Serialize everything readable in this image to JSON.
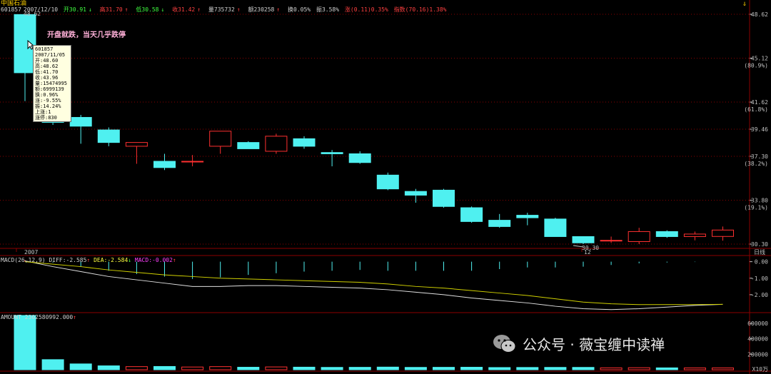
{
  "header": {
    "stock_name": "中国石油",
    "code": "601857",
    "date": "2007/12/10",
    "open": "开30.91",
    "open_arrow": "↓",
    "high": "高31.70",
    "high_arrow": "↑",
    "low": "低30.58",
    "low_arrow": "↓",
    "close": "收31.42",
    "close_arrow": "↑",
    "volume": "量735732",
    "volume_arrow": "↑",
    "amount": "额230258",
    "amount_arrow": "↑",
    "turnover": "换0.05%",
    "amplitude": "振3.58%",
    "change": "涨(0.11)0.35%",
    "index": "指数(70.16)1.38%"
  },
  "annotation": "开盘就跌，当天几乎跌停",
  "tooltip": {
    "lines": [
      "601857",
      "2007/11/05",
      "开:48.60",
      "高:48.62",
      "低:41.70",
      "收:43.96",
      "量:15474995",
      "额:6999139",
      "换:0.96%",
      "涨:-9.55%",
      "振:14.24%",
      "上涨:1",
      "涨停:830"
    ]
  },
  "price_axis": {
    "labels": [
      "48.62",
      "45.12",
      "41.62",
      "39.46",
      "37.30",
      "33.80",
      "30.30"
    ],
    "pct_labels": [
      "(80.9%)",
      "(61.8%)",
      "(38.2%)",
      "(19.1%)"
    ]
  },
  "top_price_label": "48.62",
  "low_price_label": "30.30",
  "x_axis": {
    "label_2007": "2007",
    "label_12": "12",
    "period": "日线"
  },
  "macd": {
    "label": "MACD(26,12,9)",
    "diff": "DIFF:-2.585",
    "diff_arrow": "↑",
    "dea": "DEA:-2.584",
    "dea_arrow": "↓",
    "macd_val": "MACD:-0.002",
    "macd_arrow": "↑",
    "axis_labels": [
      "0.00",
      "-1.00",
      "-2.00"
    ]
  },
  "amount_panel": {
    "label": "AMOUNT 2302580992.000",
    "arrow": "↑",
    "axis_labels": [
      "600000",
      "400000",
      "200000",
      "X10万"
    ]
  },
  "watermark": "公众号 · 薇宝缠中读禅",
  "colors": {
    "up": "#ff3030",
    "down": "#4ff0f0",
    "grid": "#8b0000",
    "diff": "#e0e0e0",
    "dea": "#d0d000"
  },
  "chart_data": {
    "type": "candlestick",
    "candles": [
      {
        "o": 48.6,
        "h": 48.62,
        "l": 41.7,
        "c": 43.96,
        "amt": 69.99
      },
      {
        "o": 43.2,
        "h": 43.8,
        "l": 39.8,
        "c": 40.0,
        "amt": 13.0
      },
      {
        "o": 40.4,
        "h": 40.6,
        "l": 38.3,
        "c": 39.7,
        "amt": 7.5
      },
      {
        "o": 39.4,
        "h": 39.6,
        "l": 38.1,
        "c": 38.4,
        "amt": 5.0
      },
      {
        "o": 38.1,
        "h": 38.4,
        "l": 36.7,
        "c": 38.4,
        "amt": 4.0
      },
      {
        "o": 36.9,
        "h": 37.5,
        "l": 36.2,
        "c": 36.4,
        "amt": 4.2
      },
      {
        "o": 36.9,
        "h": 37.4,
        "l": 36.5,
        "c": 36.9,
        "amt": 3.5
      },
      {
        "o": 38.1,
        "h": 39.2,
        "l": 37.5,
        "c": 39.3,
        "amt": 4.0
      },
      {
        "o": 38.4,
        "h": 38.5,
        "l": 37.9,
        "c": 37.9,
        "amt": 3.2
      },
      {
        "o": 37.7,
        "h": 39.1,
        "l": 37.5,
        "c": 38.9,
        "amt": 3.6
      },
      {
        "o": 38.7,
        "h": 38.9,
        "l": 37.9,
        "c": 38.1,
        "amt": 3.3
      },
      {
        "o": 37.6,
        "h": 37.8,
        "l": 36.5,
        "c": 37.5,
        "amt": 3.0
      },
      {
        "o": 37.5,
        "h": 37.7,
        "l": 36.7,
        "c": 36.8,
        "amt": 3.1
      },
      {
        "o": 35.8,
        "h": 36.0,
        "l": 34.6,
        "c": 34.7,
        "amt": 3.4
      },
      {
        "o": 34.5,
        "h": 34.7,
        "l": 33.6,
        "c": 34.2,
        "amt": 3.0
      },
      {
        "o": 34.6,
        "h": 34.7,
        "l": 33.2,
        "c": 33.3,
        "amt": 3.1
      },
      {
        "o": 33.2,
        "h": 33.3,
        "l": 32.0,
        "c": 32.1,
        "amt": 3.2
      },
      {
        "o": 32.2,
        "h": 32.7,
        "l": 31.6,
        "c": 31.7,
        "amt": 2.8
      },
      {
        "o": 32.6,
        "h": 32.8,
        "l": 31.8,
        "c": 32.4,
        "amt": 2.9
      },
      {
        "o": 32.3,
        "h": 32.4,
        "l": 30.9,
        "c": 30.9,
        "amt": 3.0
      },
      {
        "o": 30.9,
        "h": 30.9,
        "l": 30.3,
        "c": 30.4,
        "amt": 3.0
      },
      {
        "o": 30.6,
        "h": 30.9,
        "l": 30.4,
        "c": 30.6,
        "amt": 2.4
      },
      {
        "o": 30.5,
        "h": 31.6,
        "l": 30.3,
        "c": 31.3,
        "amt": 2.6
      },
      {
        "o": 31.3,
        "h": 31.4,
        "l": 30.8,
        "c": 30.9,
        "amt": 2.4
      },
      {
        "o": 30.9,
        "h": 31.3,
        "l": 30.6,
        "c": 31.1,
        "amt": 2.3
      },
      {
        "o": 30.91,
        "h": 31.7,
        "l": 30.58,
        "c": 31.42,
        "amt": 2.3
      }
    ],
    "macd_bars": [
      0.1,
      -0.05,
      -0.3,
      -0.55,
      -0.75,
      -0.9,
      -1.05,
      -0.95,
      -0.8,
      -0.7,
      -0.6,
      -0.55,
      -0.5,
      -0.55,
      -0.55,
      -0.55,
      -0.55,
      -0.45,
      -0.35,
      -0.35,
      -0.3,
      -0.2,
      -0.1,
      -0.05,
      -0.02,
      -0.002
    ],
    "diff": [
      0.05,
      -0.3,
      -0.6,
      -0.9,
      -1.1,
      -1.3,
      -1.5,
      -1.5,
      -1.45,
      -1.45,
      -1.5,
      -1.55,
      -1.6,
      -1.7,
      -1.85,
      -2.0,
      -2.2,
      -2.35,
      -2.5,
      -2.7,
      -2.85,
      -2.9,
      -2.85,
      -2.75,
      -2.65,
      -2.585
    ],
    "dea": [
      0.0,
      -0.15,
      -0.3,
      -0.5,
      -0.65,
      -0.8,
      -0.9,
      -1.0,
      -1.05,
      -1.1,
      -1.15,
      -1.2,
      -1.25,
      -1.35,
      -1.5,
      -1.6,
      -1.75,
      -1.9,
      -2.05,
      -2.25,
      -2.45,
      -2.55,
      -2.6,
      -2.6,
      -2.6,
      -2.584
    ],
    "ylim_price": [
      30.3,
      48.62
    ],
    "ylim_macd": [
      -3.0,
      0.2
    ],
    "ylim_amount": [
      0,
      700000
    ]
  }
}
